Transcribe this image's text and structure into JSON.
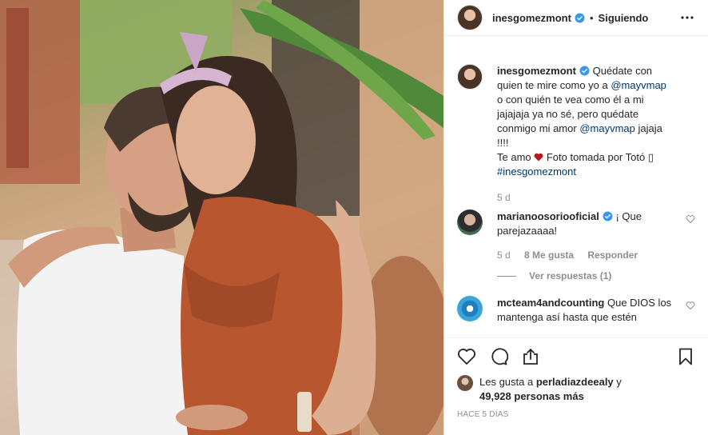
{
  "post": {
    "owner": "inesgomezmont",
    "follow_status": "Siguiendo",
    "separator": "•",
    "caption": {
      "author": "inesgomezmont",
      "line1": "Quédate con",
      "line2a": "quien te mire como yo a ",
      "mention1": "@mayvmap",
      "line3": "o con quién te vea como él a mi",
      "line4": "jajajaja ya no sé, pero quédate",
      "line5a": "conmigo mi amor ",
      "mention2": "@mayvmap",
      "line5b": " jajaja",
      "line6": "!!!!",
      "line7a": "Te amo ",
      "line7b": " Foto tomada por Totó ",
      "box_glyph": "▯",
      "hashtag": "#inesgomezmont",
      "time": "5 d"
    },
    "comments": [
      {
        "user": "marianoosoriooficial",
        "text": " ¡ Que parejazaaaa!",
        "time": "5 d",
        "likes": "8 Me gusta",
        "reply": "Responder",
        "view_replies": "Ver respuestas (1)"
      },
      {
        "user": "mcteam4andcounting",
        "text": " Que DIOS los mantenga así hasta que estén"
      }
    ],
    "likes": {
      "prefix": "Les gusta a ",
      "user": "perladiazdeealy",
      "mid": " y",
      "count": "49,928 personas más"
    },
    "ago": "HACE 5 DÍAS"
  },
  "icons": {
    "verified": "verified-badge-icon",
    "more": "more-options-icon",
    "heart": "heart-icon",
    "comment": "comment-icon",
    "share": "share-icon",
    "save": "bookmark-icon"
  },
  "colors": {
    "verified": "#3897f0",
    "mention": "#00376b",
    "muted": "#8e8e8e",
    "heart_red": "#ed4956"
  }
}
